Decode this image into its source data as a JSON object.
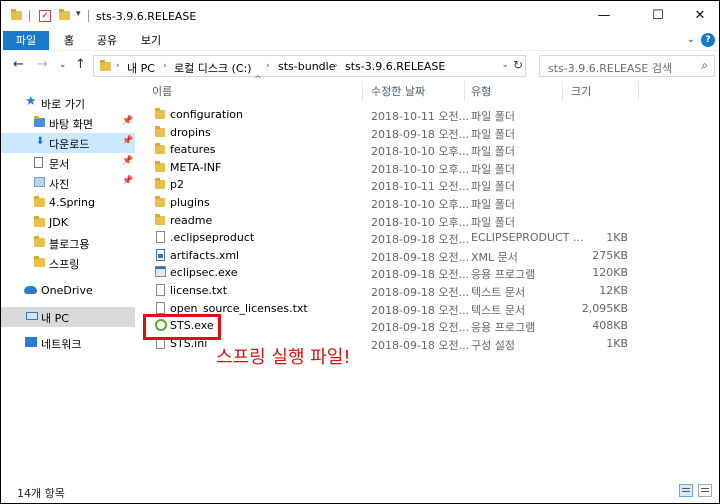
{
  "window": {
    "title": "sts-3.9.6.RELEASE",
    "controls": {
      "minimize": "—",
      "maximize": "☐",
      "close": "✕"
    }
  },
  "ribbon": {
    "tabs": [
      "파일",
      "홈",
      "공유",
      "보기"
    ],
    "expand_glyph": "⌄",
    "help_glyph": "?"
  },
  "address": {
    "crumbs": [
      "내 PC",
      "로컬 디스크 (C:)",
      "sts-bundle",
      "sts-3.9.6.RELEASE"
    ],
    "search_placeholder": "sts-3.9.6.RELEASE 검색"
  },
  "nav_pane": {
    "quick_access": "바로 가기",
    "pinned": [
      "바탕 화면",
      "다운로드",
      "문서",
      "사진"
    ],
    "folders": [
      "4.Spring",
      "JDK",
      "블로그용",
      "스프링"
    ],
    "onedrive": "OneDrive",
    "this_pc": "내 PC",
    "network": "네트워크"
  },
  "columns": {
    "name": "이름",
    "date": "수정한 날짜",
    "type": "유형",
    "size": "크기"
  },
  "files": [
    {
      "icon": "folder",
      "name": "configuration",
      "date": "2018-10-11 오전...",
      "type": "파일 폴더",
      "size": ""
    },
    {
      "icon": "folder",
      "name": "dropins",
      "date": "2018-09-18 오전...",
      "type": "파일 폴더",
      "size": ""
    },
    {
      "icon": "folder",
      "name": "features",
      "date": "2018-10-10 오후...",
      "type": "파일 폴더",
      "size": ""
    },
    {
      "icon": "folder",
      "name": "META-INF",
      "date": "2018-10-10 오후...",
      "type": "파일 폴더",
      "size": ""
    },
    {
      "icon": "folder",
      "name": "p2",
      "date": "2018-10-11 오전...",
      "type": "파일 폴더",
      "size": ""
    },
    {
      "icon": "folder",
      "name": "plugins",
      "date": "2018-10-10 오후...",
      "type": "파일 폴더",
      "size": ""
    },
    {
      "icon": "folder",
      "name": "readme",
      "date": "2018-10-10 오후...",
      "type": "파일 폴더",
      "size": ""
    },
    {
      "icon": "file",
      "name": ".eclipseproduct",
      "date": "2018-09-18 오전...",
      "type": "ECLIPSEPRODUCT ...",
      "size": "1KB"
    },
    {
      "icon": "xml",
      "name": "artifacts.xml",
      "date": "2018-09-18 오전...",
      "type": "XML 문서",
      "size": "275KB"
    },
    {
      "icon": "exe",
      "name": "eclipsec.exe",
      "date": "2018-09-18 오전...",
      "type": "응용 프로그램",
      "size": "120KB"
    },
    {
      "icon": "file",
      "name": "license.txt",
      "date": "2018-09-18 오전...",
      "type": "텍스트 문서",
      "size": "12KB"
    },
    {
      "icon": "file",
      "name": "open_source_licenses.txt",
      "date": "2018-09-18 오전...",
      "type": "텍스트 문서",
      "size": "2,095KB"
    },
    {
      "icon": "spring",
      "name": "STS.exe",
      "date": "2018-09-18 오전...",
      "type": "응용 프로그램",
      "size": "408KB"
    },
    {
      "icon": "file",
      "name": "STS.ini",
      "date": "2018-09-18 오전...",
      "type": "구성 설정",
      "size": "1KB"
    }
  ],
  "annotation": "스프링 실행 파일!",
  "status": {
    "item_count": "14개 항목"
  },
  "colors": {
    "accent": "#1979ca",
    "annotation": "#e01010",
    "folder": "#e8c04a"
  }
}
